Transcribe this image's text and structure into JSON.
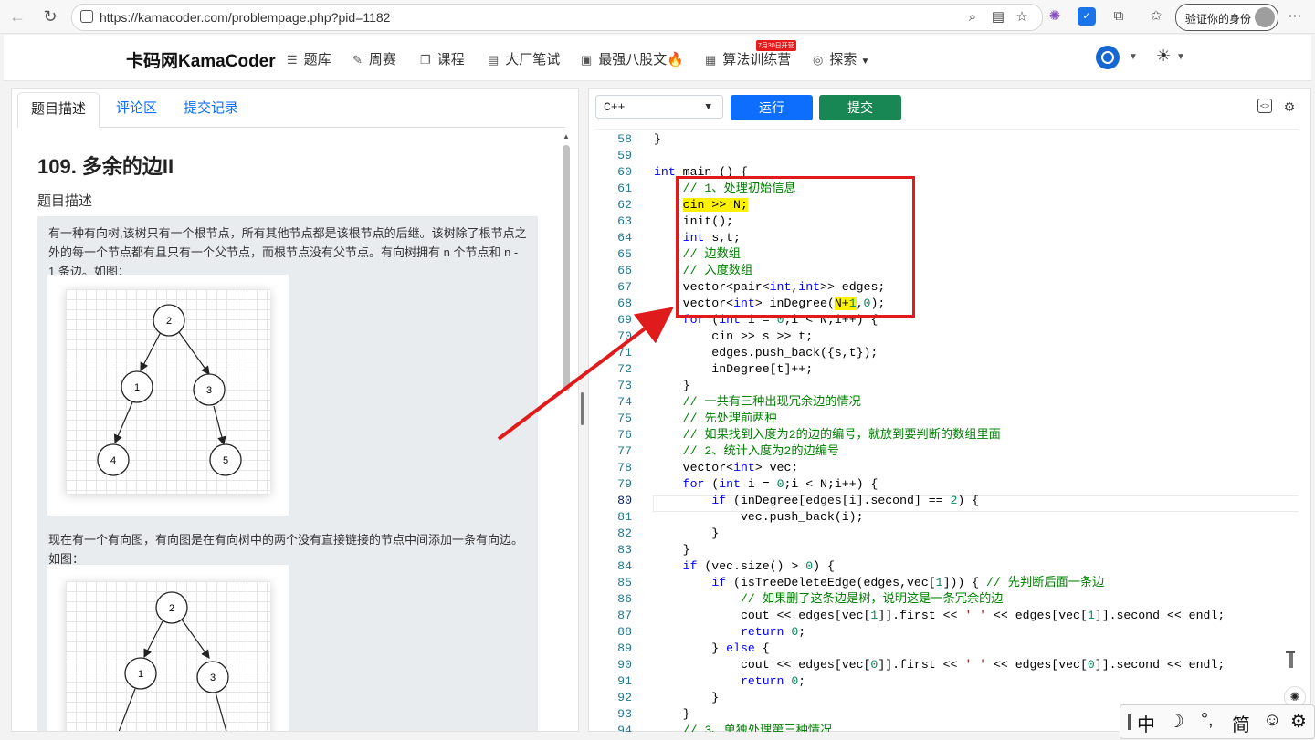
{
  "browser": {
    "url": "https://kamacoder.com/problempage.php?pid=1182",
    "profile_label": "验证你的身份"
  },
  "site": {
    "brand": "卡码网KamaCoder",
    "menu": [
      "题库",
      "周赛",
      "课程",
      "大厂笔试",
      "最强八股文🔥",
      "算法训练营",
      "探索"
    ],
    "badge": "7月30日开营"
  },
  "left": {
    "tabs": [
      "题目描述",
      "评论区",
      "提交记录"
    ],
    "title": "109. 多余的边II",
    "section": "题目描述",
    "paragraph1": "有一种有向树,该树只有一个根节点，所有其他节点都是该根节点的后继。该树除了根节点之外的每一个节点都有且只有一个父节点，而根节点没有父节点。有向树拥有 n 个节点和 n - 1 条边。如图：",
    "paragraph2": "现在有一个有向图，有向图是在有向树中的两个没有直接链接的节点中间添加一条有向边。如图：",
    "tree1_nodes": [
      "2",
      "1",
      "3",
      "4",
      "5"
    ],
    "tree2_nodes": [
      "2",
      "1",
      "3"
    ]
  },
  "right": {
    "language": "C++",
    "run_label": "运行",
    "submit_label": "提交",
    "current_line": 80,
    "code_lines": [
      {
        "n": 58,
        "t": "}"
      },
      {
        "n": 59,
        "t": ""
      },
      {
        "n": 60,
        "t": "int main () {"
      },
      {
        "n": 61,
        "t": "    // 1、处理初始信息"
      },
      {
        "n": 62,
        "t": "    cin >> N;"
      },
      {
        "n": 63,
        "t": "    init();"
      },
      {
        "n": 64,
        "t": "    int s,t;"
      },
      {
        "n": 65,
        "t": "    // 边数组"
      },
      {
        "n": 66,
        "t": "    // 入度数组"
      },
      {
        "n": 67,
        "t": "    vector<pair<int,int>> edges;"
      },
      {
        "n": 68,
        "t": "    vector<int> inDegree(N+1,0);"
      },
      {
        "n": 69,
        "t": "    for (int i = 0;i < N;i++) {"
      },
      {
        "n": 70,
        "t": "        cin >> s >> t;"
      },
      {
        "n": 71,
        "t": "        edges.push_back({s,t});"
      },
      {
        "n": 72,
        "t": "        inDegree[t]++;"
      },
      {
        "n": 73,
        "t": "    }"
      },
      {
        "n": 74,
        "t": "    // 一共有三种出现冗余边的情况"
      },
      {
        "n": 75,
        "t": "    // 先处理前两种"
      },
      {
        "n": 76,
        "t": "    // 如果找到入度为2的边的编号，就放到要判断的数组里面"
      },
      {
        "n": 77,
        "t": "    // 2、统计入度为2的边编号"
      },
      {
        "n": 78,
        "t": "    vector<int> vec;"
      },
      {
        "n": 79,
        "t": "    for (int i = 0;i < N;i++) {"
      },
      {
        "n": 80,
        "t": "        if (inDegree[edges[i].second] == 2) {"
      },
      {
        "n": 81,
        "t": "            vec.push_back(i);"
      },
      {
        "n": 82,
        "t": "        }"
      },
      {
        "n": 83,
        "t": "    }"
      },
      {
        "n": 84,
        "t": "    if (vec.size() > 0) {"
      },
      {
        "n": 85,
        "t": "        if (isTreeDeleteEdge(edges,vec[1])) { // 先判断后面一条边"
      },
      {
        "n": 86,
        "t": "            // 如果删了这条边是树，说明这是一条冗余的边"
      },
      {
        "n": 87,
        "t": "            cout << edges[vec[1]].first << ' ' << edges[vec[1]].second << endl;"
      },
      {
        "n": 88,
        "t": "            return 0;"
      },
      {
        "n": 89,
        "t": "        } else {"
      },
      {
        "n": 90,
        "t": "            cout << edges[vec[0]].first << ' ' << edges[vec[0]].second << endl;"
      },
      {
        "n": 91,
        "t": "            return 0;"
      },
      {
        "n": 92,
        "t": "        }"
      },
      {
        "n": 93,
        "t": "    }"
      },
      {
        "n": 94,
        "t": "    // 3、单独处理第三种情况"
      }
    ]
  },
  "ime": [
    "中",
    "☽",
    "°,",
    "简",
    "☺",
    "⚙"
  ],
  "colors": {
    "primary": "#0d6efd",
    "success": "#198754",
    "highlight": "#fff200",
    "annotation": "#e01b1b"
  }
}
